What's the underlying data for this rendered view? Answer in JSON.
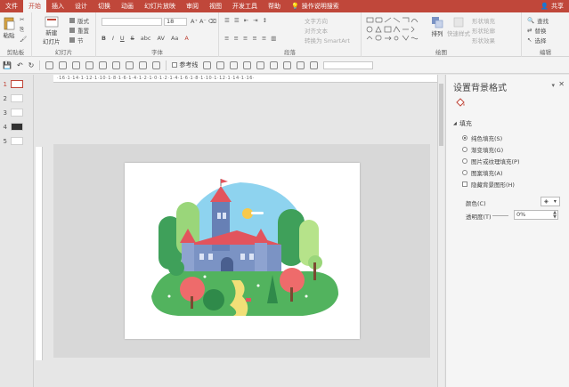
{
  "tabs": [
    "文件",
    "开始",
    "插入",
    "设计",
    "切换",
    "动画",
    "幻灯片放映",
    "审阅",
    "视图",
    "开发工具",
    "帮助"
  ],
  "active_tab": "开始",
  "tell_me": "操作说明搜索",
  "share": "共享",
  "ribbon": {
    "clipboard": {
      "paste": "粘贴",
      "label": "剪贴板"
    },
    "slides": {
      "new_slide": "新建\n幻灯片",
      "layout": "版式",
      "reset": "重置",
      "section": "节",
      "label": "幻灯片"
    },
    "font": {
      "size": "18",
      "label": "字体",
      "buttons": [
        "B",
        "I",
        "U",
        "S",
        "abc",
        "AV",
        "Aa",
        "A"
      ]
    },
    "paragraph": {
      "label": "段落",
      "text_direction": "文字方向",
      "align_text": "对齐文本",
      "smartart": "转换为 SmartArt"
    },
    "drawing": {
      "arrange": "排列",
      "quick_styles": "快速样式",
      "fill": "形状填充",
      "outline": "形状轮廓",
      "effects": "形状效果",
      "label": "绘图"
    },
    "editing": {
      "find": "查找",
      "replace": "替换",
      "select": "选择",
      "label": "编辑"
    }
  },
  "qat": {
    "reference_line": "参考线"
  },
  "thumbnails": [
    "1",
    "2",
    "3",
    "4",
    "5"
  ],
  "ruler": "·16·1·14·1·12·1·10·1·8·1·6·1·4·1·2·1·0·1·2·1·4·1·6·1·8·1·10·1·12·1·14·1·16·",
  "pane": {
    "title": "设置背景格式",
    "section": "填充",
    "options": [
      {
        "label": "纯色填充(S)",
        "selected": true
      },
      {
        "label": "渐变填充(G)",
        "selected": false
      },
      {
        "label": "图片或纹理填充(P)",
        "selected": false
      },
      {
        "label": "图案填充(A)",
        "selected": false
      }
    ],
    "hide_bg": "隐藏背景图形(H)",
    "color_label": "颜色(C)",
    "transparency_label": "透明度(T)",
    "transparency_value": "0%"
  },
  "colors": {
    "accent": "#c0473a",
    "sky": "#6cc4e8",
    "green": "#3fa05a",
    "castle": "#7b93c4",
    "roof": "#e2545d"
  }
}
